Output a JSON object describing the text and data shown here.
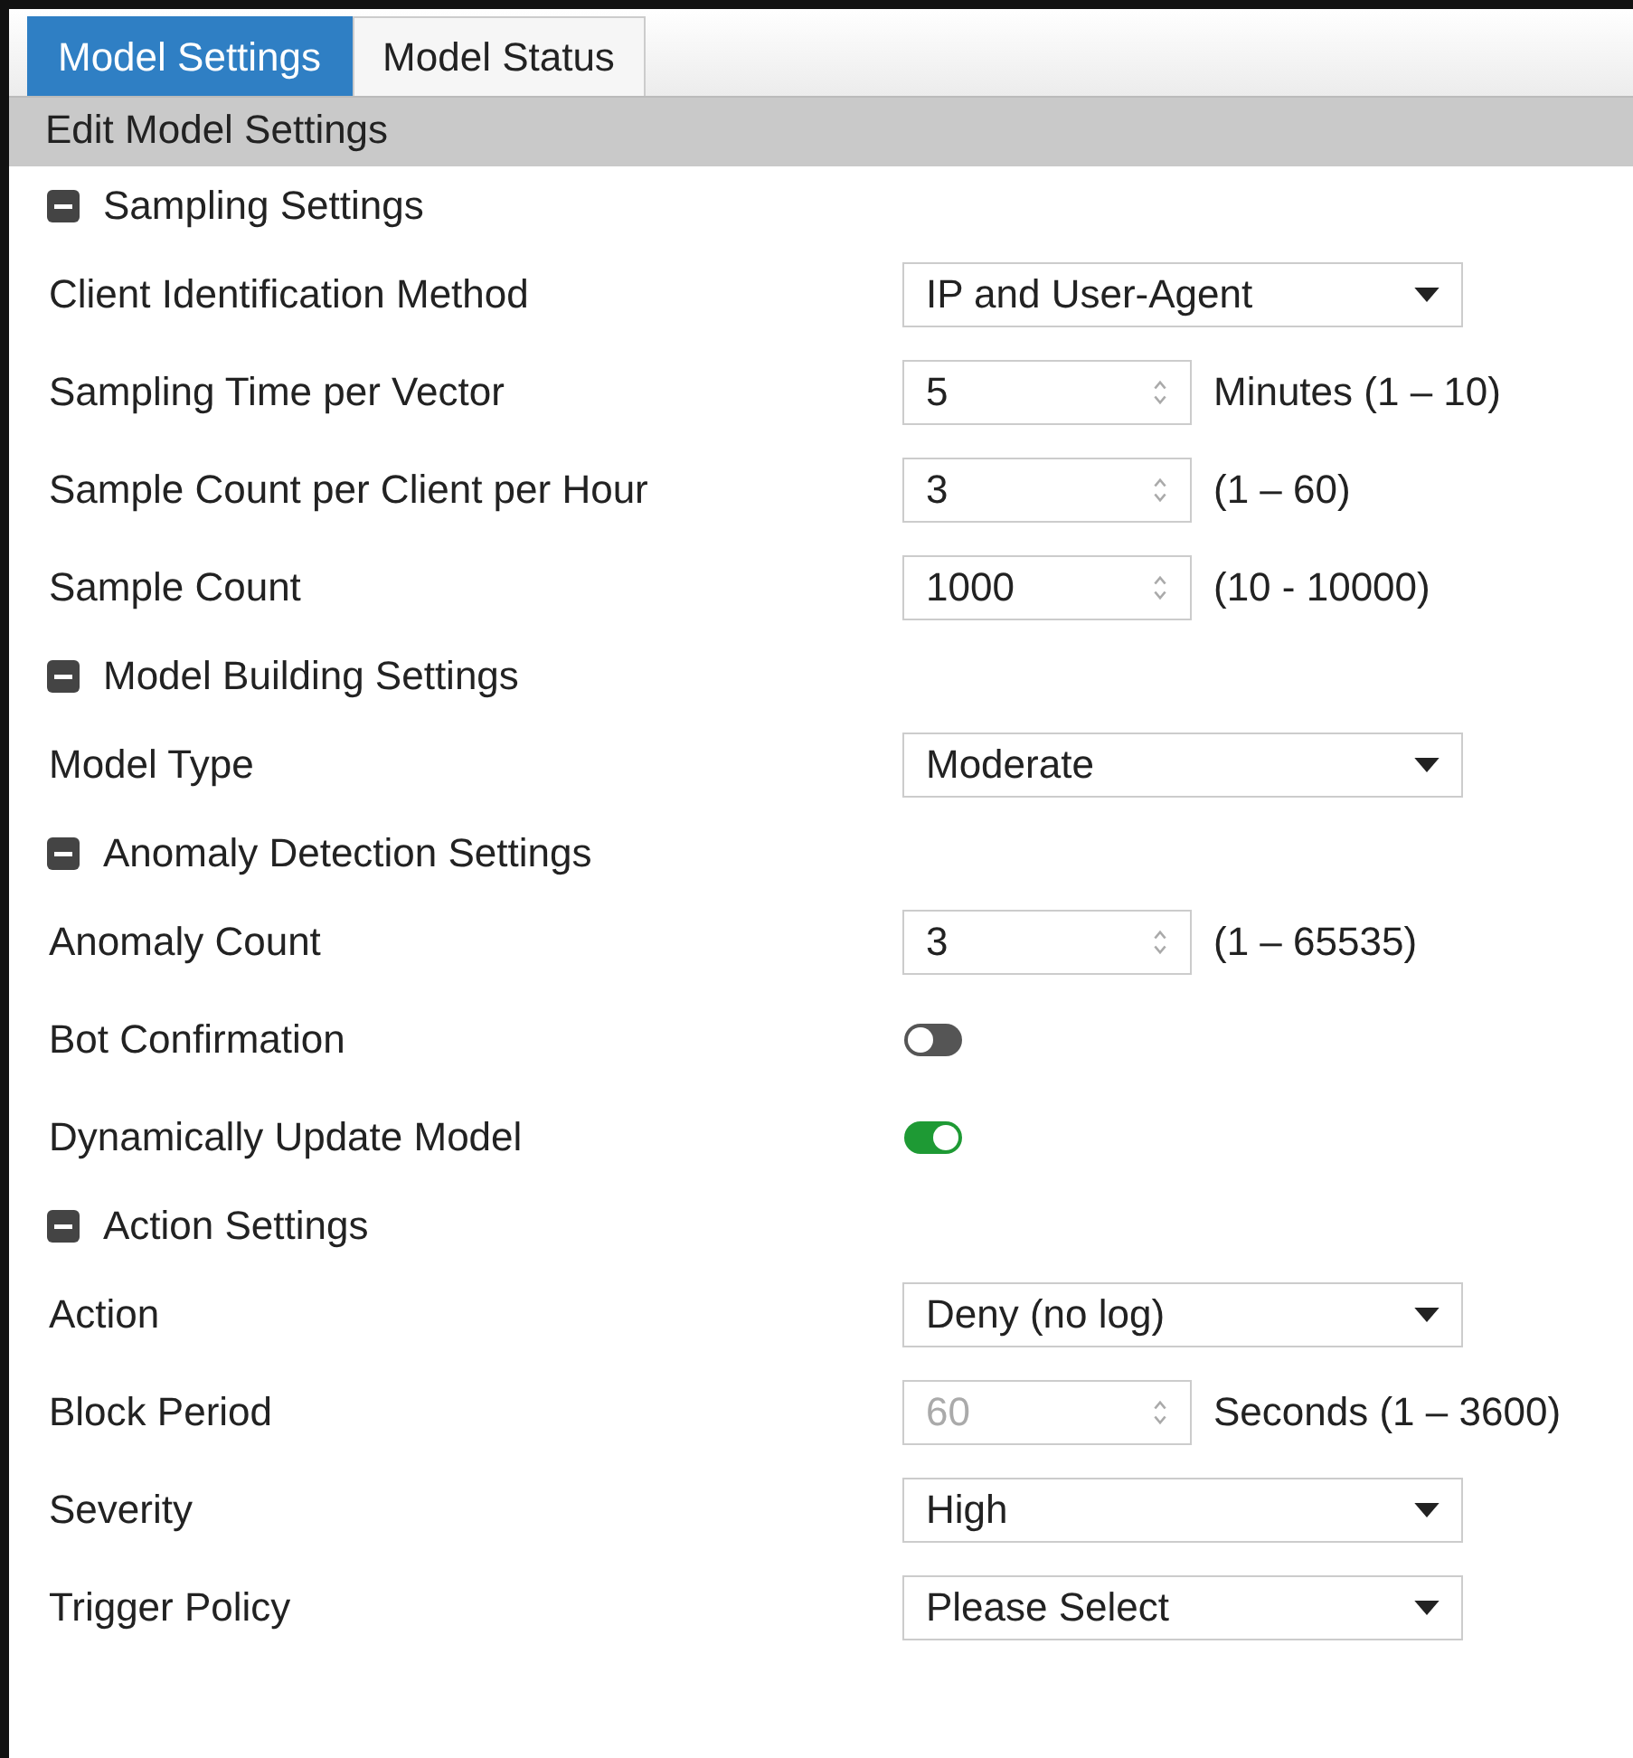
{
  "tabs": [
    {
      "label": "Model Settings",
      "selected": true
    },
    {
      "label": "Model Status",
      "selected": false
    }
  ],
  "panel_title": "Edit Model Settings",
  "sections": [
    {
      "title": "Sampling Settings",
      "expanded": true,
      "rows": [
        {
          "kind": "select",
          "label": "Client Identification Method",
          "value": "IP and User-Agent"
        },
        {
          "kind": "number",
          "label": "Sampling Time per Vector",
          "value": "5",
          "disabled": false,
          "hint": "Minutes (1 – 10)"
        },
        {
          "kind": "number",
          "label": "Sample Count per Client per Hour",
          "value": "3",
          "disabled": false,
          "hint": "(1 – 60)"
        },
        {
          "kind": "number",
          "label": "Sample Count",
          "value": "1000",
          "disabled": false,
          "hint": "(10 - 10000)"
        }
      ]
    },
    {
      "title": "Model Building Settings",
      "expanded": true,
      "rows": [
        {
          "kind": "select",
          "label": "Model Type",
          "value": "Moderate"
        }
      ]
    },
    {
      "title": "Anomaly Detection Settings",
      "expanded": true,
      "rows": [
        {
          "kind": "number",
          "label": "Anomaly Count",
          "value": "3",
          "disabled": false,
          "hint": "(1 – 65535)"
        },
        {
          "kind": "toggle",
          "label": "Bot Confirmation",
          "on": false
        },
        {
          "kind": "toggle",
          "label": "Dynamically Update Model",
          "on": true
        }
      ]
    },
    {
      "title": "Action Settings",
      "expanded": true,
      "rows": [
        {
          "kind": "select",
          "label": "Action",
          "value": "Deny (no log)"
        },
        {
          "kind": "number",
          "label": "Block Period",
          "value": "60",
          "disabled": true,
          "hint": "Seconds (1 – 3600)"
        },
        {
          "kind": "select",
          "label": "Severity",
          "value": "High"
        },
        {
          "kind": "select",
          "label": "Trigger Policy",
          "value": "Please Select"
        }
      ]
    }
  ]
}
